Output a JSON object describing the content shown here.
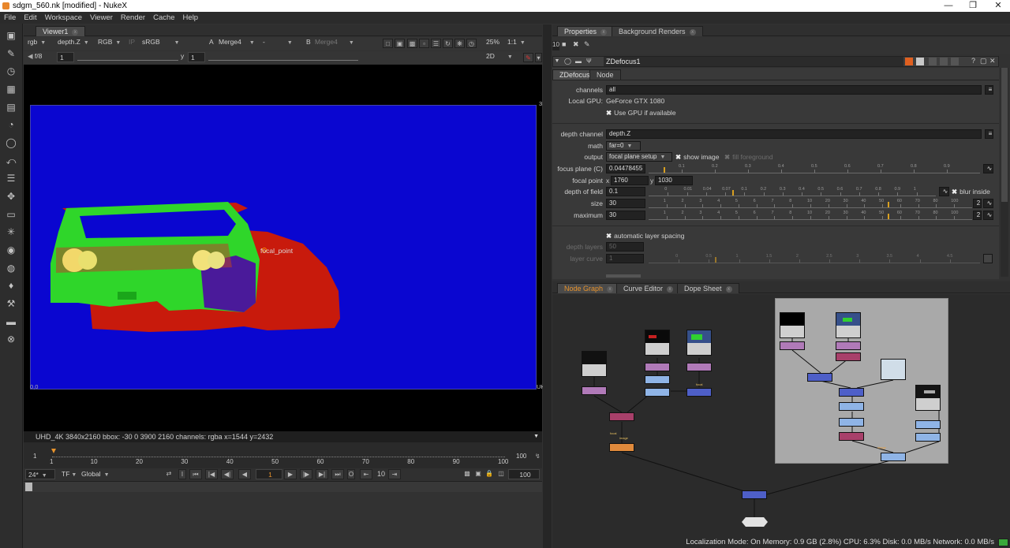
{
  "window": {
    "title": "sdgm_560.nk [modified] - NukeX",
    "minimize_icon": "minimize-icon",
    "maximize_icon": "maximize-icon",
    "close_icon": "close-icon"
  },
  "menu": [
    "File",
    "Edit",
    "Workspace",
    "Viewer",
    "Render",
    "Cache",
    "Help"
  ],
  "viewer": {
    "tab": "Viewer1",
    "channels": "rgb",
    "layer": "depth.Z",
    "display": "RGB",
    "ip": "IP",
    "lut": "sRGB",
    "input_a_letter": "A",
    "input_a": "Merge4",
    "operation": "-",
    "input_b_letter": "B",
    "input_b": "Merge4",
    "zoom": "25%",
    "proxy": "1:1",
    "fstop": "f/8",
    "gain_value": "1",
    "y_label": "y",
    "gamma_value": "1",
    "view_mode": "2D",
    "gain_ticks": [
      "0.0625",
      "0.25",
      "1",
      "4",
      "16",
      "64"
    ],
    "gamma_ticks": [
      "0.2",
      "0.4",
      "0.6",
      "0.8",
      "1",
      "1.2",
      "1.4",
      "1.6",
      "1.8"
    ],
    "overlay_label": "focal_point",
    "corner_bl": "0,0",
    "corner_br": "UHD",
    "corner_tr": "3",
    "status": "UHD_4K 3840x2160  bbox: -30 0 3900 2160 channels: rgba  x=1544 y=2432"
  },
  "timeline": {
    "start": "1",
    "end": "100",
    "ticks": [
      "1",
      "10",
      "20",
      "30",
      "40",
      "50",
      "60",
      "70",
      "80",
      "90",
      "100"
    ],
    "fps": "24*",
    "tf": "TF",
    "scope": "Global",
    "frame": "1",
    "skip": "10",
    "end_field": "100"
  },
  "properties": {
    "tabs": [
      "Properties",
      "Background Renders"
    ],
    "max_panels": "10",
    "node_name": "ZDefocus1",
    "inner_tabs": [
      "ZDefocus",
      "Node"
    ],
    "channels_label": "channels",
    "channels_value": "all",
    "gpu_label": "Local GPU:",
    "gpu_value": "GeForce GTX 1080",
    "use_gpu": "Use GPU if available",
    "depth_channel_label": "depth channel",
    "depth_channel_value": "depth.Z",
    "math_label": "math",
    "math_value": "far=0",
    "output_label": "output",
    "output_value": "focal plane setup",
    "show_image": "show image",
    "fill_foreground": "fill foreground",
    "focus_plane_label": "focus plane (C)",
    "focus_plane_value": "0.04478455",
    "focus_plane_ticks": [
      "0.1",
      "0.2",
      "0.3",
      "0.4",
      "0.5",
      "0.6",
      "0.7",
      "0.8",
      "0.9"
    ],
    "focal_point_label": "focal point",
    "fp_x_label": "x",
    "fp_x": "1760",
    "fp_y_label": "y",
    "fp_y": "1030",
    "dof_label": "depth of field",
    "dof_value": "0.1",
    "blur_inside": "blur inside",
    "dof_ticks": [
      "0",
      "0.01",
      "0.04",
      "0.07",
      "0.1",
      "0.2",
      "0.3",
      "0.4",
      "0.5",
      "0.6",
      "0.7",
      "0.8",
      "0.9",
      "1"
    ],
    "size_label": "size",
    "size_value": "30",
    "size_badge": "2",
    "max_label": "maximum",
    "max_value": "30",
    "max_badge": "2",
    "size_ticks": [
      "1",
      "2",
      "3",
      "4",
      "5",
      "6",
      "7",
      "8",
      "10",
      "20",
      "30",
      "40",
      "50",
      "60",
      "70",
      "80",
      "100"
    ],
    "auto_layer": "automatic layer spacing",
    "depth_layers_label": "depth layers",
    "depth_layers_value": "50",
    "layer_curve_label": "layer curve",
    "layer_curve_value": "1",
    "layer_curve_ticks": [
      "0",
      "0.5",
      "1",
      "1.5",
      "2",
      "2.5",
      "3",
      "3.5",
      "4",
      "4.5"
    ]
  },
  "node_graph": {
    "tabs": [
      "Node Graph",
      "Curve Editor",
      "Dope Sheet"
    ],
    "labels": [
      "focal",
      "image",
      "focal",
      "image",
      "focal"
    ]
  },
  "statusbar": "Localization Mode: On  Memory: 0.9 GB (2.8%)  CPU: 6.3%  Disk: 0.0 MB/s  Network: 0.0 MB/s",
  "colors": {
    "plate_blue": "#0a06d0",
    "accent_orange": "#e8932c",
    "green": "#2fd62a",
    "red": "#c81a0c"
  }
}
